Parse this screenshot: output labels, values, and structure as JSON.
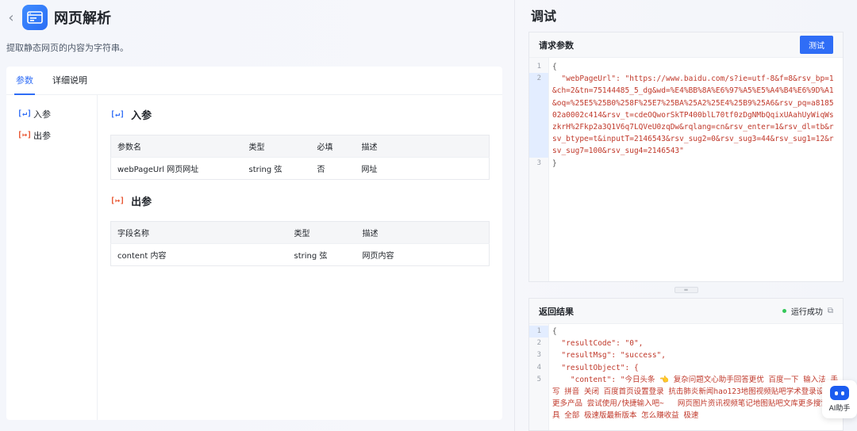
{
  "header": {
    "back_icon": "chevron-left-icon",
    "title": "网页解析",
    "subtitle": "提取静态网页的内容为字符串。"
  },
  "tabs": [
    {
      "label": "参数",
      "active": true
    },
    {
      "label": "详细说明",
      "active": false
    }
  ],
  "sidebar": {
    "items": [
      {
        "label": "入参"
      },
      {
        "label": "出参"
      }
    ]
  },
  "input_section": {
    "title": "入参",
    "columns": [
      "参数名",
      "类型",
      "必填",
      "描述"
    ],
    "rows": [
      {
        "name": "webPageUrl  网页网址",
        "type": "string  弦",
        "required": "否",
        "desc": "网址"
      }
    ]
  },
  "output_section": {
    "title": "出参",
    "columns": [
      "字段名称",
      "类型",
      "描述"
    ],
    "rows": [
      {
        "name": "content  内容",
        "type": "string  弦",
        "desc": "网页内容"
      }
    ]
  },
  "debug": {
    "title": "调试",
    "request": {
      "title": "请求参数",
      "button": "测试",
      "line_numbers": [
        "1",
        "2",
        "",
        "",
        "",
        "",
        "",
        "",
        "3"
      ],
      "lines": [
        "{",
        "  \"webPageUrl\": \"https://www.baidu.com/s?ie=utf-8&f=8&rsv_bp=1&ch=2&tn=75144485_5_dg&wd=%E4%BB%8A%E6%97%A5%E5%A4%B4%E6%9D%A1&oq=%25E5%25B0%258F%25E7%25BA%25A2%25E4%25B9%25A6&rsv_pq=a818502a0002c414&rsv_t=cdeOQworSkTP400blL70tf0zDgNMbQqixUAahUyWiqWszkrH%2Fkp2a3Q1V6q7LQVeU0zqDw&rqlang=cn&rsv_enter=1&rsv_dl=tb&rsv_btype=t&inputT=2146543&rsv_sug2=0&rsv_sug3=44&rsv_sug1=12&rsv_sug7=100&rsv_sug4=2146543\"",
        "}"
      ]
    },
    "response": {
      "title": "返回结果",
      "status": "运行成功",
      "line_numbers": [
        "1",
        "2",
        "3",
        "4",
        "5"
      ],
      "lines": [
        "{",
        "  \"resultCode\": \"0\",",
        "  \"resultMsg\": \"success\",",
        "  \"resultObject\": {",
        "    \"content\": \"今日头条 👈 复杂问题文心助手回答更优 百度一下 输入法 手写 拼音 关闭 百度首页设置登录 抗击肺炎新闻hao123地图视频贴吧学术登录设置更多产品 尝试使用/快捷输入吧~   网页图片资讯视频笔记地图贴吧文库更多搜索工具 全部 极速版最新版本 怎么赚收益 极速"
      ]
    }
  },
  "ai_assistant": {
    "label": "AI助手"
  }
}
